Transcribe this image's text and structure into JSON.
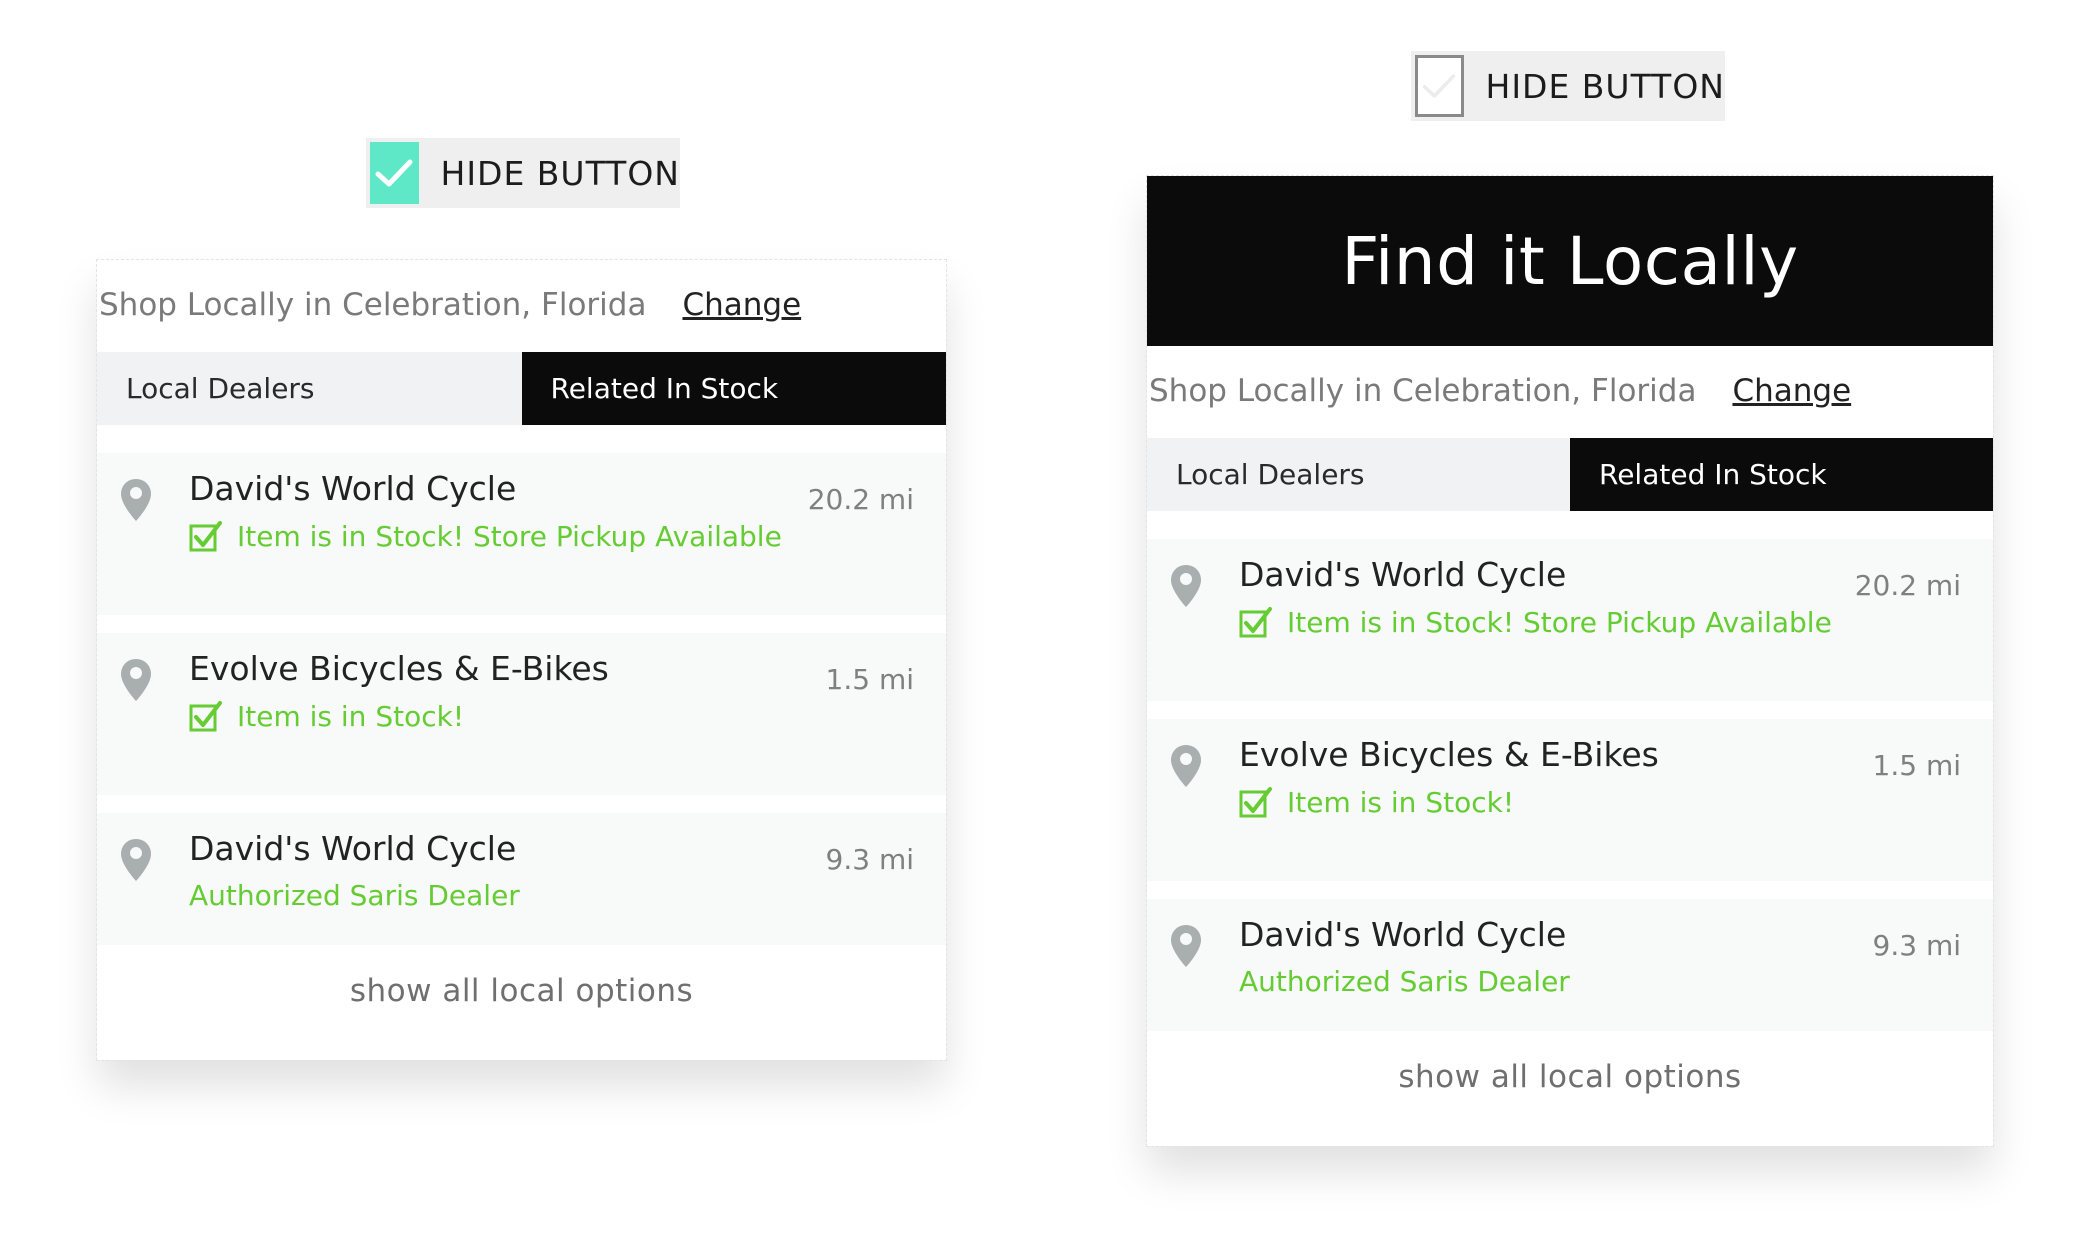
{
  "left_panel": {
    "toggle": {
      "label": "HIDE BUTTON",
      "checked": true,
      "color": "#5ee8c8"
    },
    "location": {
      "text": "Shop Locally in Celebration, Florida",
      "change_label": "Change"
    },
    "tabs": [
      {
        "label": "Local Dealers",
        "active": false
      },
      {
        "label": "Related In Stock",
        "active": true
      }
    ],
    "dealers": [
      {
        "name": "David's World Cycle",
        "distance": "20.2 mi",
        "status": "Item is in Stock! Store Pickup Available",
        "status_icon": "check-icon"
      },
      {
        "name": "Evolve Bicycles & E-Bikes",
        "distance": "1.5 mi",
        "status": "Item is in Stock!",
        "status_icon": "check-icon"
      },
      {
        "name": "David's World Cycle",
        "distance": "9.3 mi",
        "status": "Authorized Saris Dealer",
        "status_icon": ""
      }
    ],
    "show_all": "show all local options"
  },
  "right_panel": {
    "toggle": {
      "label": "HIDE BUTTON",
      "checked": false
    },
    "header": {
      "title": "Find it Locally"
    },
    "location": {
      "text": "Shop Locally in Celebration, Florida",
      "change_label": "Change"
    },
    "tabs": [
      {
        "label": "Local Dealers",
        "active": false
      },
      {
        "label": "Related In Stock",
        "active": true
      }
    ],
    "dealers": [
      {
        "name": "David's World Cycle",
        "distance": "20.2 mi",
        "status": "Item is in Stock! Store Pickup Available",
        "status_icon": "check-icon"
      },
      {
        "name": "Evolve Bicycles & E-Bikes",
        "distance": "1.5 mi",
        "status": "Item is in Stock!",
        "status_icon": "check-icon"
      },
      {
        "name": "David's World Cycle",
        "distance": "9.3 mi",
        "status": "Authorized Saris Dealer",
        "status_icon": ""
      }
    ],
    "show_all": "show all local options"
  },
  "colors": {
    "accent_green": "#66cc33",
    "toggle_teal": "#5ee8c8",
    "dark": "#0b0b0b",
    "pin_gray": "#a9aeae"
  }
}
